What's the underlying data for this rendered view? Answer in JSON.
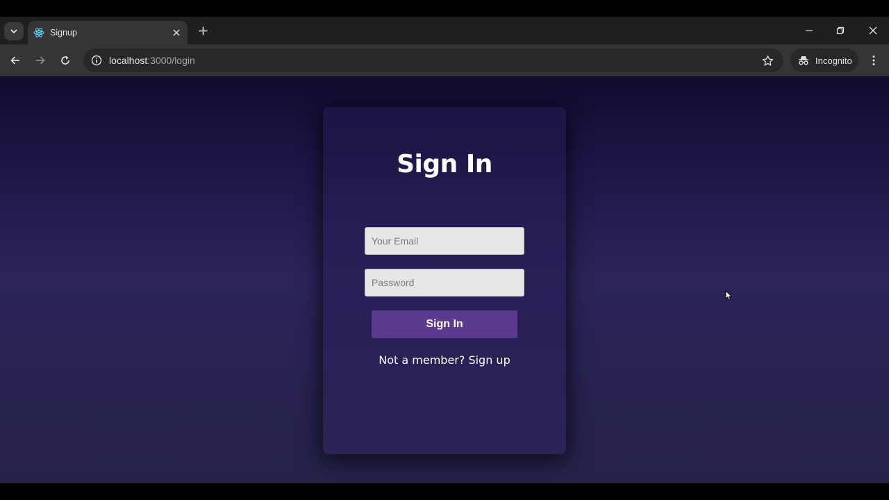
{
  "browser": {
    "tab": {
      "title": "Signup"
    },
    "address_bar": {
      "url_host": "localhost",
      "url_path": ":3000/login"
    },
    "profile_chip": {
      "label": "Incognito"
    }
  },
  "page": {
    "title": "Sign In",
    "email": {
      "placeholder": "Your Email",
      "value": ""
    },
    "password": {
      "placeholder": "Password",
      "value": ""
    },
    "submit_label": "Sign In",
    "signup_prompt": "Not a member? Sign up"
  },
  "colors": {
    "background_top": "#110b2e",
    "background_mid": "#2b2559",
    "card": "#251f55",
    "button": "#5b3a90",
    "input": "#e6e6e6"
  },
  "icons": [
    "tab-search-icon",
    "react-favicon-icon",
    "close-icon",
    "plus-icon",
    "minimize-icon",
    "restore-icon",
    "back-arrow-icon",
    "forward-arrow-icon",
    "reload-icon",
    "site-info-icon",
    "star-icon",
    "incognito-icon",
    "kebab-menu-icon",
    "mouse-cursor-icon"
  ]
}
